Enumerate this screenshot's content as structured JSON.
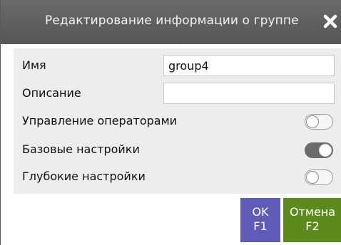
{
  "dialog": {
    "title": "Редактирование информации о группе",
    "close_icon": "close-icon"
  },
  "form": {
    "name_label": "Имя",
    "name_value": "group4",
    "description_label": "Описание",
    "description_value": "",
    "toggles": [
      {
        "label": "Управление операторами",
        "state": "off"
      },
      {
        "label": "Базовые настройки",
        "state": "on"
      },
      {
        "label": "Глубокие настройки",
        "state": "off"
      }
    ]
  },
  "buttons": {
    "ok_label": "OK",
    "ok_hotkey": "F1",
    "cancel_label": "Отмена",
    "cancel_hotkey": "F2"
  },
  "colors": {
    "titlebar": "#5f5f5f",
    "ok": "#5f5bb6",
    "cancel": "#5d8a1c",
    "toggle_on": "#6b6b6b"
  }
}
